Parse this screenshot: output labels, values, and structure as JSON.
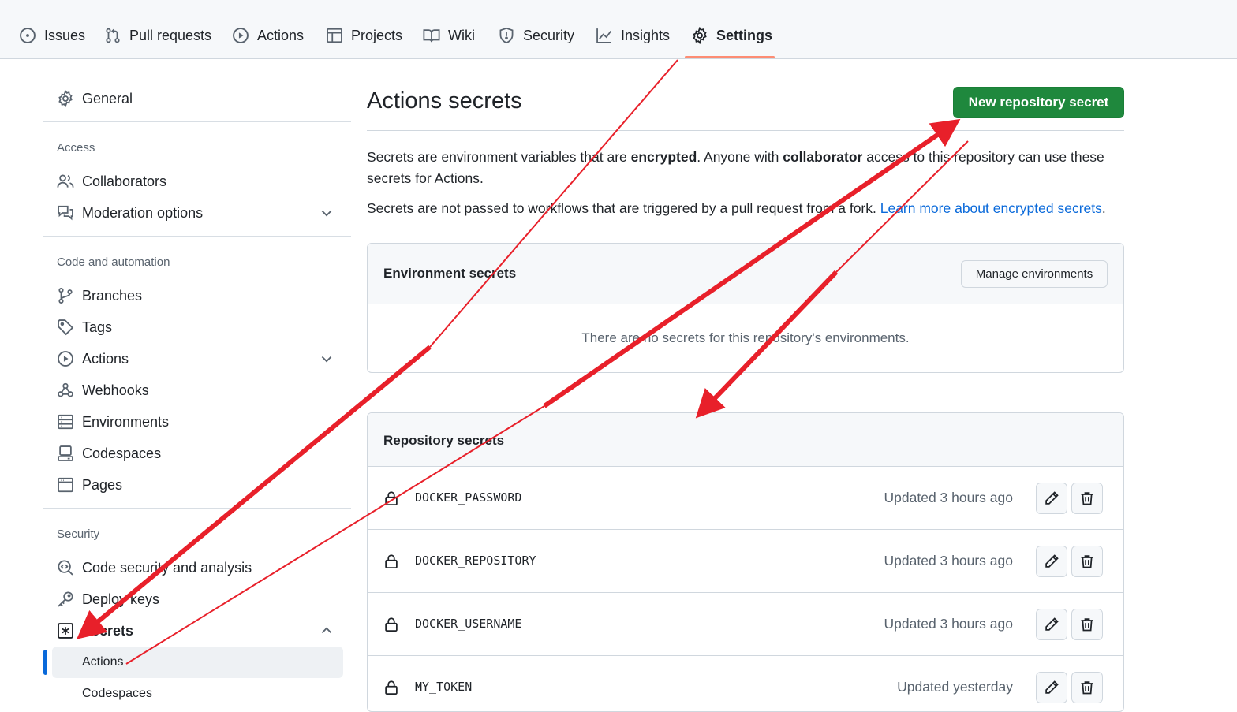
{
  "topnav": {
    "tabs": [
      {
        "label": "Issues",
        "icon": "issue-opened-icon"
      },
      {
        "label": "Pull requests",
        "icon": "git-pull-request-icon"
      },
      {
        "label": "Actions",
        "icon": "play-icon"
      },
      {
        "label": "Projects",
        "icon": "table-icon"
      },
      {
        "label": "Wiki",
        "icon": "book-icon"
      },
      {
        "label": "Security",
        "icon": "shield-icon"
      },
      {
        "label": "Insights",
        "icon": "graph-icon"
      },
      {
        "label": "Settings",
        "icon": "gear-icon",
        "selected": true
      }
    ]
  },
  "sidebar": {
    "general": "General",
    "access_heading": "Access",
    "collaborators": "Collaborators",
    "moderation": "Moderation options",
    "code_heading": "Code and automation",
    "branches": "Branches",
    "tags": "Tags",
    "actions": "Actions",
    "webhooks": "Webhooks",
    "environments": "Environments",
    "codespaces": "Codespaces",
    "pages": "Pages",
    "security_heading": "Security",
    "code_security": "Code security and analysis",
    "deploy_keys": "Deploy keys",
    "secrets": "Secrets",
    "secrets_sub": [
      "Actions",
      "Codespaces"
    ]
  },
  "main": {
    "title": "Actions secrets",
    "new_secret_button": "New repository secret",
    "desc1_a": "Secrets are environment variables that are ",
    "desc1_b": "encrypted",
    "desc1_c": ". Anyone with ",
    "desc1_d": "collaborator",
    "desc1_e": " access to this repository can use these secrets for Actions.",
    "desc2_a": "Secrets are not passed to workflows that are triggered by a pull request from a fork. ",
    "desc2_link": "Learn more about encrypted secrets",
    "desc2_end": ".",
    "env_box": {
      "title": "Environment secrets",
      "manage_button": "Manage environments",
      "empty": "There are no secrets for this repository's environments."
    },
    "repo_box": {
      "title": "Repository secrets",
      "secrets": [
        {
          "name": "DOCKER_PASSWORD",
          "updated": "Updated 3 hours ago"
        },
        {
          "name": "DOCKER_REPOSITORY",
          "updated": "Updated 3 hours ago"
        },
        {
          "name": "DOCKER_USERNAME",
          "updated": "Updated 3 hours ago"
        },
        {
          "name": "MY_TOKEN",
          "updated": "Updated yesterday"
        }
      ]
    }
  },
  "colors": {
    "primary_button": "#1f883d",
    "link": "#0969da",
    "annotation_arrow": "#e8202a",
    "selected_tab_underline": "#fd8c73"
  }
}
